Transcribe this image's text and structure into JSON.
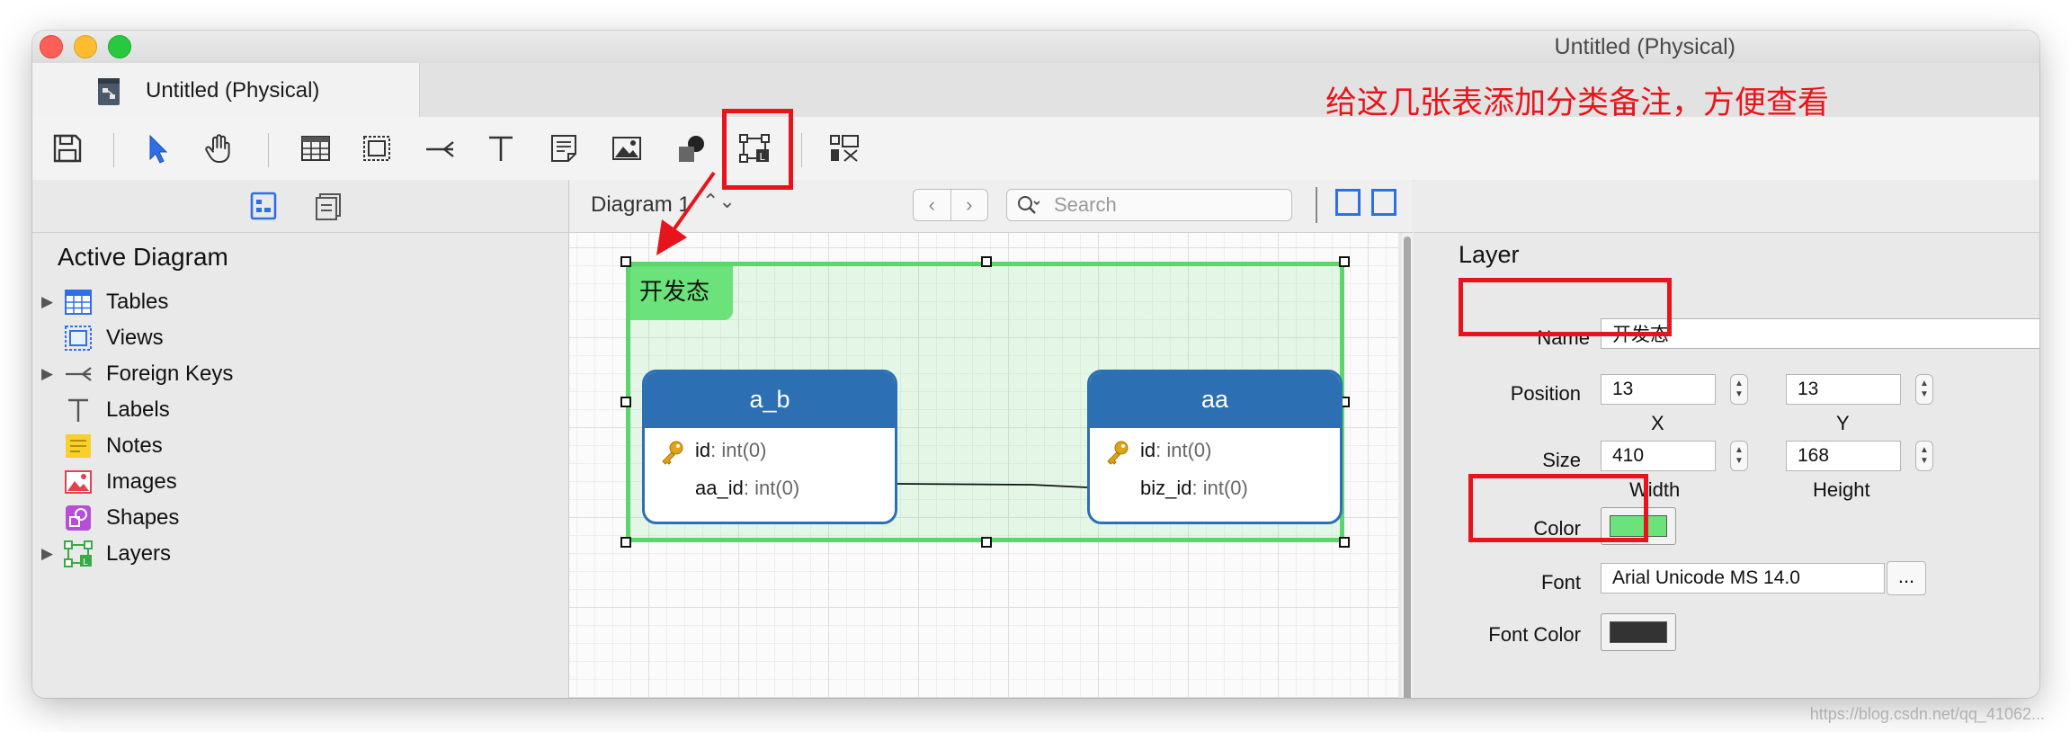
{
  "window": {
    "title": "Untitled (Physical)"
  },
  "tab": {
    "label": "Untitled (Physical)"
  },
  "toolbar": {
    "tools": [
      "save-icon",
      "pointer-icon",
      "hand-icon",
      "table-icon",
      "view-icon",
      "foreign-key-icon",
      "label-icon",
      "note-icon",
      "image-icon",
      "shape-icon",
      "layer-icon",
      "arrange-icon"
    ]
  },
  "annotation": {
    "text": "给这几张表添加分类备注，方便查看"
  },
  "sidebar": {
    "title": "Active Diagram",
    "items": [
      {
        "label": "Tables",
        "icon": "table-icon",
        "expandable": true
      },
      {
        "label": "Views",
        "icon": "view-icon",
        "expandable": false
      },
      {
        "label": "Foreign Keys",
        "icon": "foreign-key-icon",
        "expandable": true
      },
      {
        "label": "Labels",
        "icon": "label-icon",
        "expandable": false
      },
      {
        "label": "Notes",
        "icon": "note-icon",
        "expandable": false
      },
      {
        "label": "Images",
        "icon": "image-icon",
        "expandable": false
      },
      {
        "label": "Shapes",
        "icon": "shape-icon",
        "expandable": false
      },
      {
        "label": "Layers",
        "icon": "layer-icon",
        "expandable": true
      }
    ]
  },
  "canvas_header": {
    "diagram_name": "Diagram 1",
    "nav_prev": "‹",
    "nav_next": "›",
    "search_placeholder": "Search"
  },
  "diagram": {
    "layer": {
      "name": "开发态",
      "color": "#6ce37a"
    },
    "entities": [
      {
        "name": "a_b",
        "fields": [
          {
            "name": "id",
            "type": ": int(0)",
            "key": true
          },
          {
            "name": "aa_id",
            "type": ": int(0)",
            "key": false
          }
        ]
      },
      {
        "name": "aa",
        "fields": [
          {
            "name": "id",
            "type": ": int(0)",
            "key": true
          },
          {
            "name": "biz_id",
            "type": ": int(0)",
            "key": false
          }
        ]
      }
    ]
  },
  "properties": {
    "section": "Layer",
    "name_label": "Name",
    "name_value": "开发态",
    "position_label": "Position",
    "position_x": "13",
    "position_y": "13",
    "x_label": "X",
    "y_label": "Y",
    "size_label": "Size",
    "width_value": "410",
    "height_value": "168",
    "width_label": "Width",
    "height_label": "Height",
    "color_label": "Color",
    "color_value": "#6ce37a",
    "font_label": "Font",
    "font_value": "Arial Unicode MS 14.0",
    "font_button": "...",
    "font_color_label": "Font Color",
    "font_color_value": "#333333"
  },
  "watermark": "https://blog.csdn.net/qq_41062..."
}
